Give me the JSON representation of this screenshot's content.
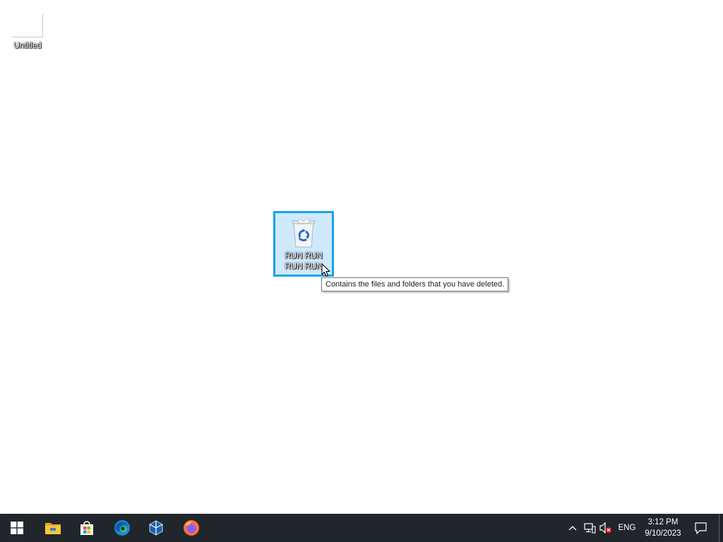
{
  "desktop": {
    "icons": [
      {
        "label": "Untitled",
        "icon": "blank-document-icon"
      },
      {
        "label": "RUN RUN RUN RUN",
        "icon": "recycle-bin-icon"
      }
    ],
    "tooltip": "Contains the files and folders that you have deleted."
  },
  "taskbar": {
    "apps": [
      "start-windows-icon",
      "file-explorer-icon",
      "microsoft-store-icon",
      "edge-icon",
      "virtualbox-icon",
      "firefox-icon"
    ],
    "tray": {
      "language": "ENG",
      "time": "3:12 PM",
      "date": "9/10/2023"
    }
  },
  "colors": {
    "taskbar_bg": "#20262b",
    "selection_bg": "#cfe8fb",
    "selection_border": "#1aa3e8"
  }
}
